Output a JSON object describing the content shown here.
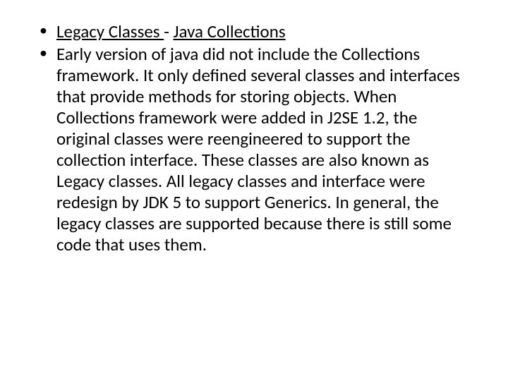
{
  "bullets": [
    {
      "title_part1": "Legacy Classes ",
      "title_separator": "- ",
      "title_part2": "Java Collections"
    },
    {
      "body": "Early version of java did not include the Collections framework. It only defined several classes and interfaces that provide methods for storing objects. When Collections framework were added in J2SE 1.2, the original classes were reengineered to support the collection interface. These classes are also known as Legacy classes. All legacy classes and interface were redesign by JDK 5 to support Generics. In general, the legacy classes are supported because there is still some code that uses them."
    }
  ]
}
